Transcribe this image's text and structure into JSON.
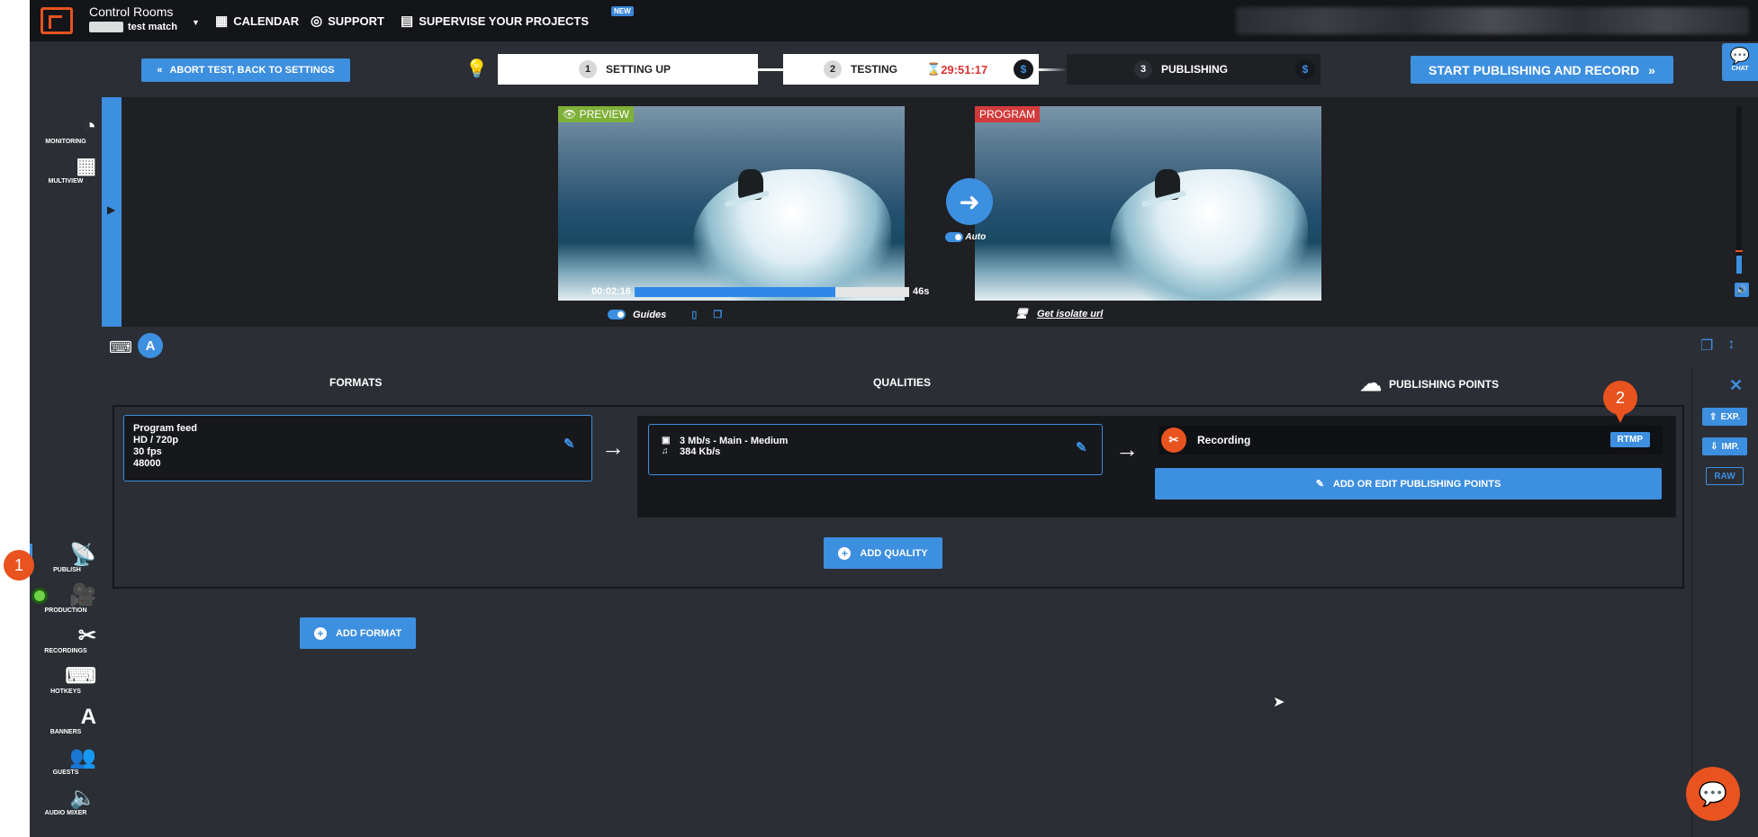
{
  "app": {
    "name": "Control Rooms",
    "project": "test match"
  },
  "nav": {
    "calendar": "CALENDAR",
    "support": "SUPPORT",
    "supervise": "SUPERVISE YOUR PROJECTS",
    "new_badge": "NEW"
  },
  "steps": {
    "abort": "ABORT TEST, BACK TO SETTINGS",
    "s1_num": "1",
    "s1_label": "SETTING UP",
    "s2_num": "2",
    "s2_label": "TESTING",
    "s2_timer": "29:51:17",
    "s3_num": "3",
    "s3_label": "PUBLISHING",
    "dollar": "$",
    "start": "START PUBLISHING AND RECORD",
    "chat": "CHAT"
  },
  "sidebar": {
    "monitoring": "MONITORING",
    "multiview": "MULTIVIEW",
    "publish": "PUBLISH",
    "production": "PRODUCTION",
    "recordings": "RECORDINGS",
    "hotkeys": "HOTKEYS",
    "banners": "BANNERS",
    "guests": "GUESTS",
    "audio_mixer": "AUDIO MIXER"
  },
  "markers": {
    "one": "1",
    "two": "2"
  },
  "video": {
    "preview_label": "PREVIEW",
    "program_label": "PROGRAM",
    "elapsed": "00:02:16",
    "remaining": "46s",
    "progress_fraction": 0.73,
    "auto": "Auto",
    "guides": "Guides",
    "isolate": "Get isolate url"
  },
  "lower": {
    "a_letter": "A",
    "formats_head": "FORMATS",
    "qualities_head": "QUALITIES",
    "pp_head": "PUBLISHING POINTS",
    "format": {
      "name": "Program feed",
      "res": "HD / 720p",
      "fps": "30 fps",
      "rate": "48000"
    },
    "quality": {
      "video": "3 Mb/s  -  Main  -  Medium",
      "audio": "384 Kb/s"
    },
    "recording": "Recording",
    "rtmp": "RTMP",
    "add_pp": "ADD OR EDIT PUBLISHING POINTS",
    "add_quality": "ADD QUALITY",
    "add_format": "ADD FORMAT",
    "exp": "EXP.",
    "imp": "IMP.",
    "raw": "RAW"
  },
  "colors": {
    "accent": "#3d8fe0",
    "orange": "#e8531f",
    "bg": "#2b2e34",
    "dark": "#16181c"
  }
}
